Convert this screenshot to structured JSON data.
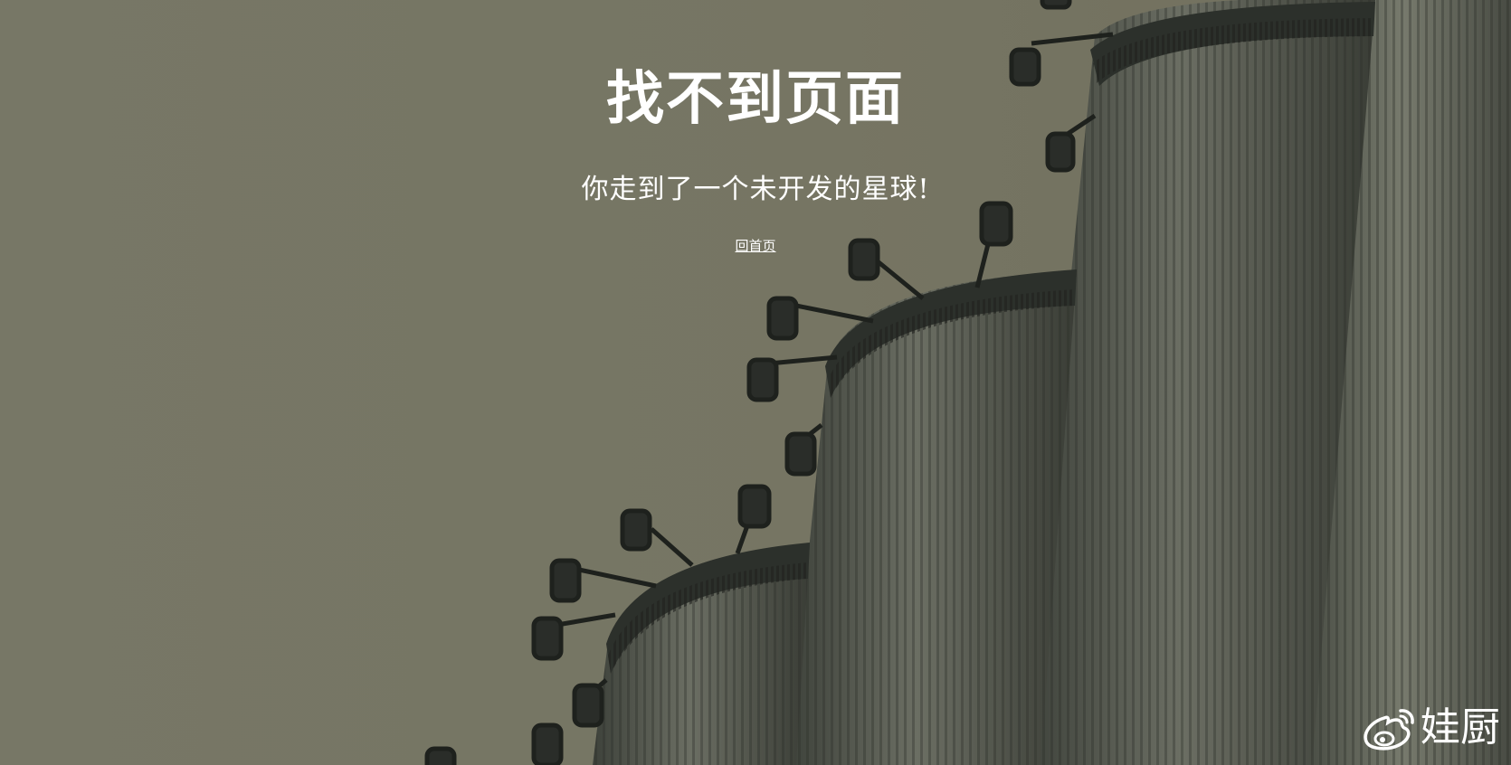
{
  "error": {
    "title": "找不到页面",
    "subtitle": "你走到了一个未开发的星球!",
    "home_link_label": "回首页"
  },
  "watermark": {
    "icon": "weibo-icon",
    "text": "娃厨"
  },
  "colors": {
    "background": "#777766",
    "silo_dark": "#2c302b",
    "silo_mid": "#4a4e45",
    "text": "#ffffff"
  }
}
